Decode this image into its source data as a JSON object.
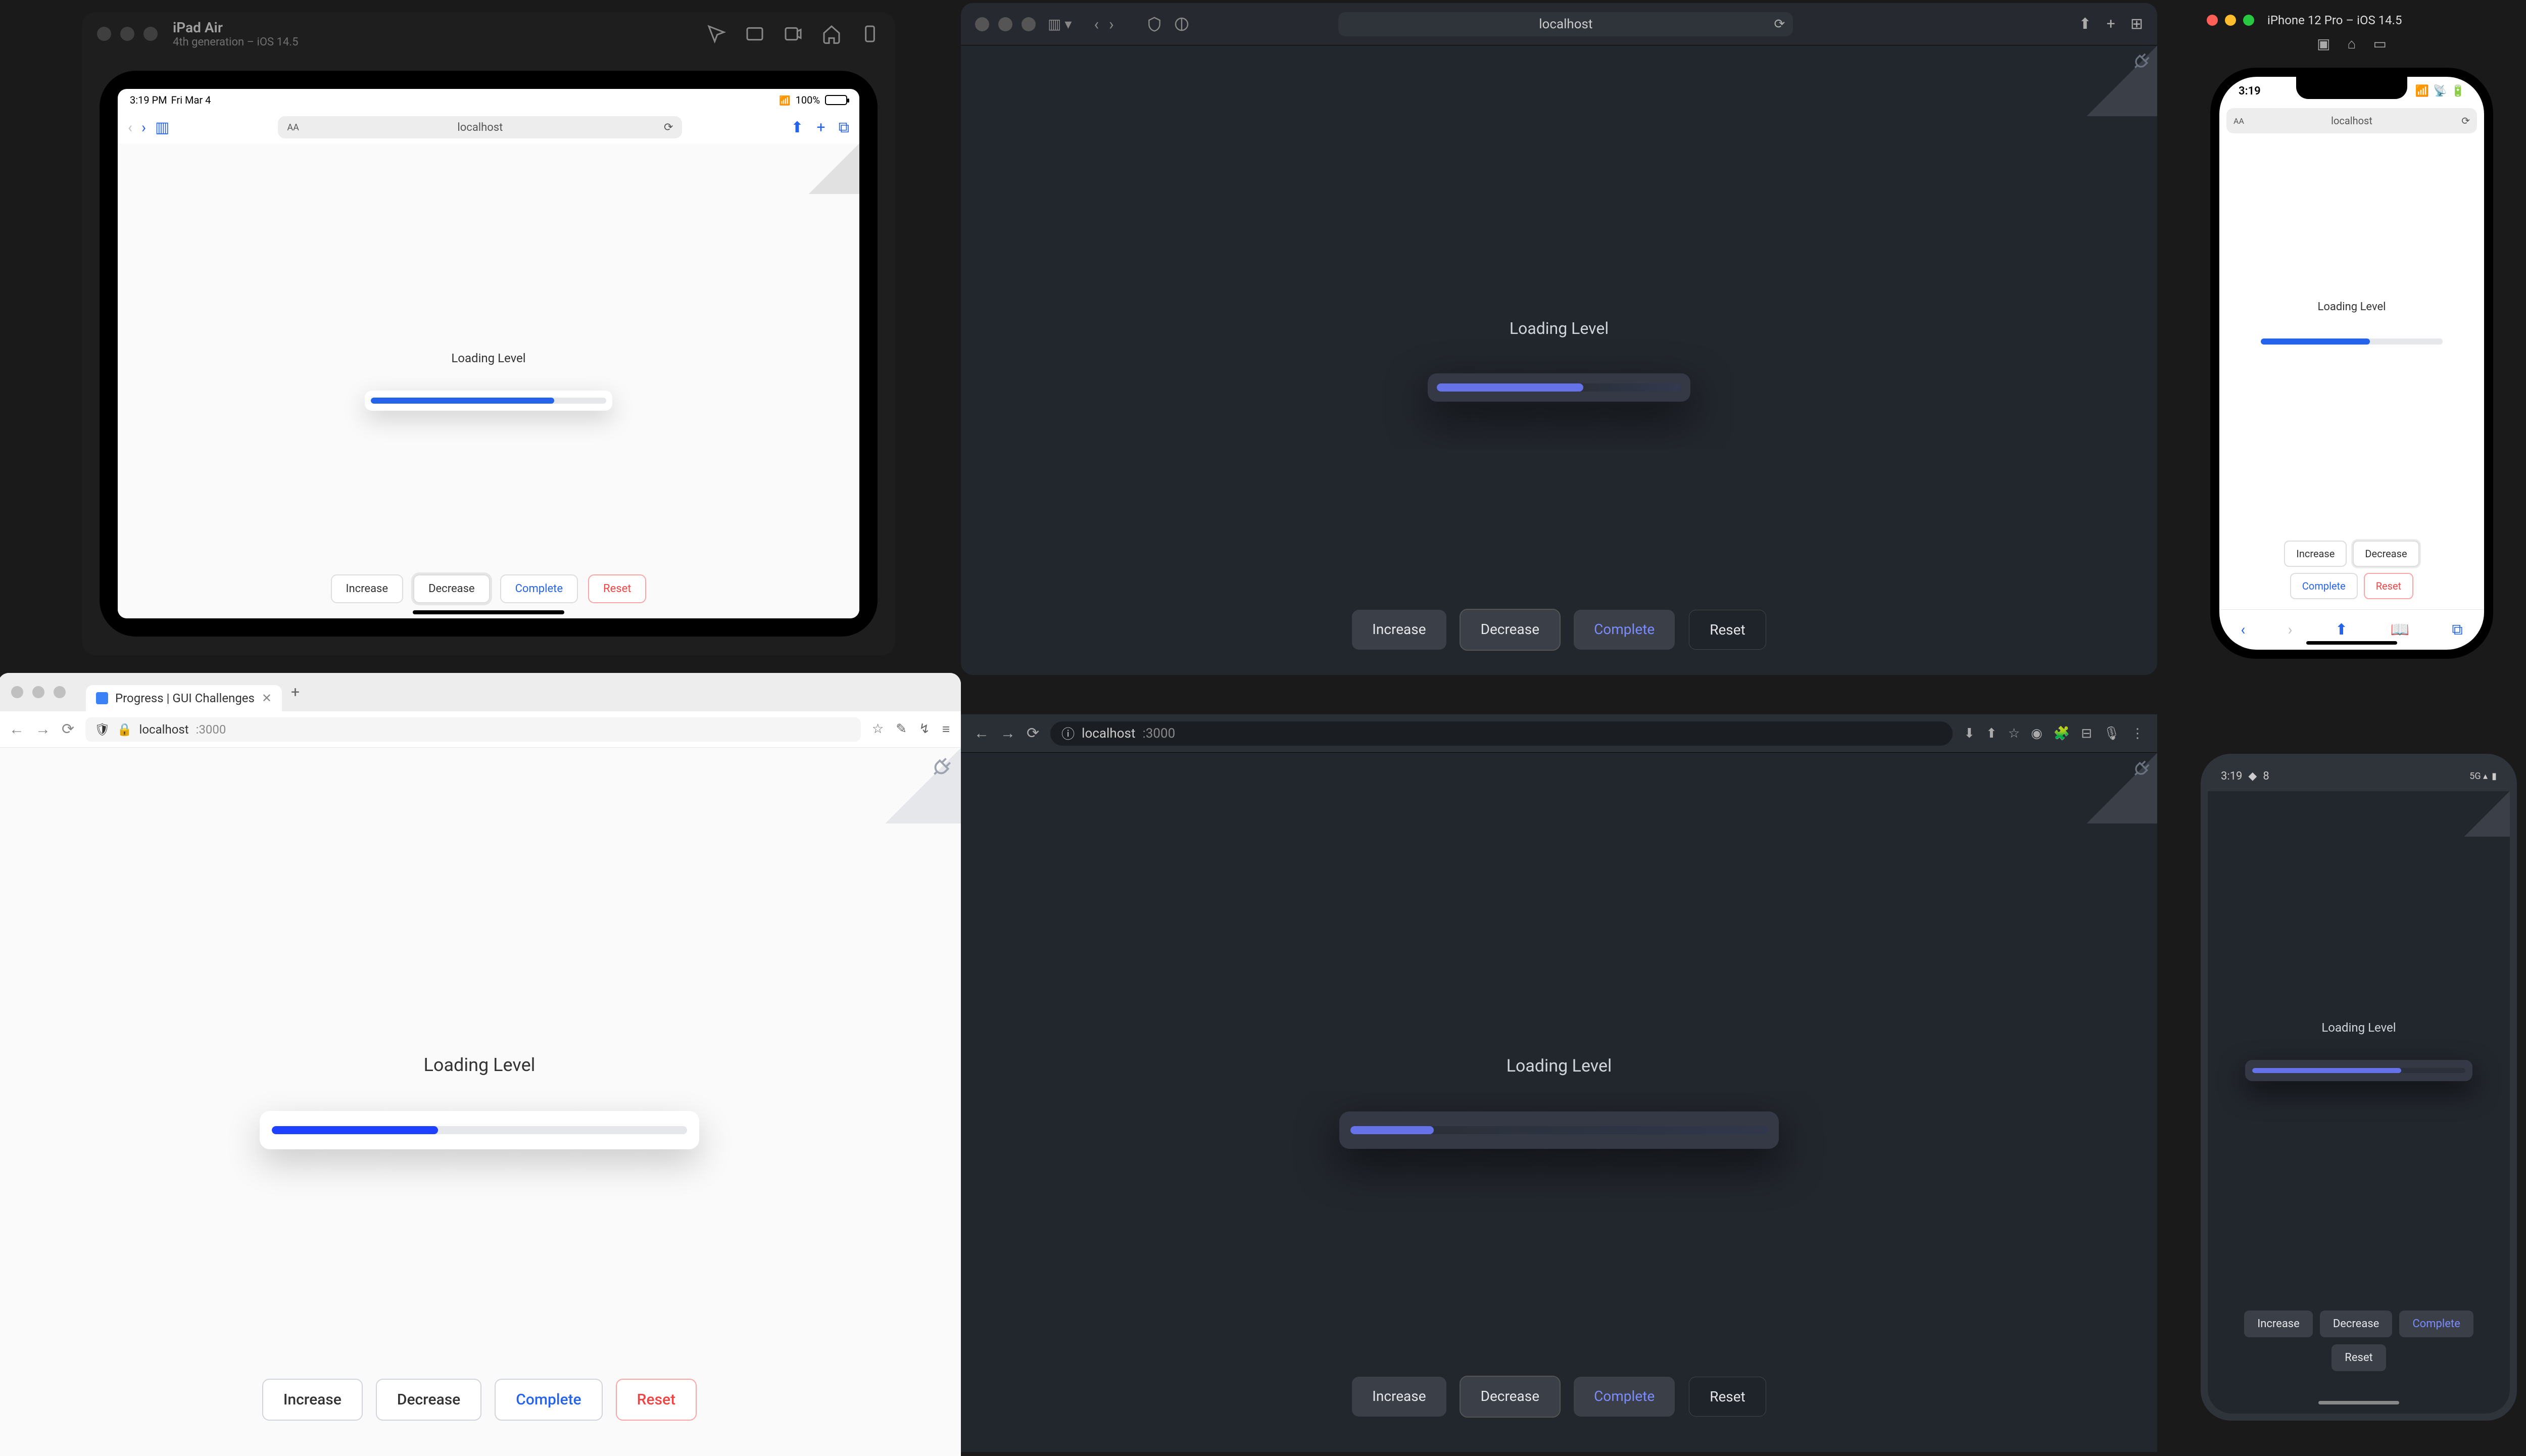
{
  "demo": {
    "loading_label": "Loading Level",
    "buttons": {
      "increase": "Increase",
      "decrease": "Decrease",
      "complete": "Complete",
      "reset": "Reset"
    }
  },
  "ipad": {
    "window_title": "iPad Air",
    "window_subtitle": "4th generation – iOS 14.5",
    "status": {
      "time": "3:19 PM",
      "date": "Fri Mar 4",
      "battery_pct": "100%"
    },
    "url": "localhost",
    "progress_pct": 78
  },
  "safari": {
    "url": "localhost",
    "progress_pct": 60
  },
  "iphone": {
    "window_title": "iPhone 12 Pro – iOS 14.5",
    "status_time": "3:19",
    "url": "localhost",
    "progress_pct": 60
  },
  "firefox": {
    "tab_title": "Progress | GUI Challenges",
    "url_host": "localhost",
    "url_port": ":3000",
    "progress_pct": 40
  },
  "chrome": {
    "url_host": "localhost",
    "url_port": ":3000",
    "progress_pct": 20
  },
  "android": {
    "status_time": "3:19",
    "status_extra": "8",
    "progress_pct": 70
  },
  "colors": {
    "accent_blue": "#2563eb",
    "accent_indigo": "#6672e8",
    "danger": "#ef4444",
    "dark_bg": "#22262d",
    "light_bg": "#fafafa"
  }
}
